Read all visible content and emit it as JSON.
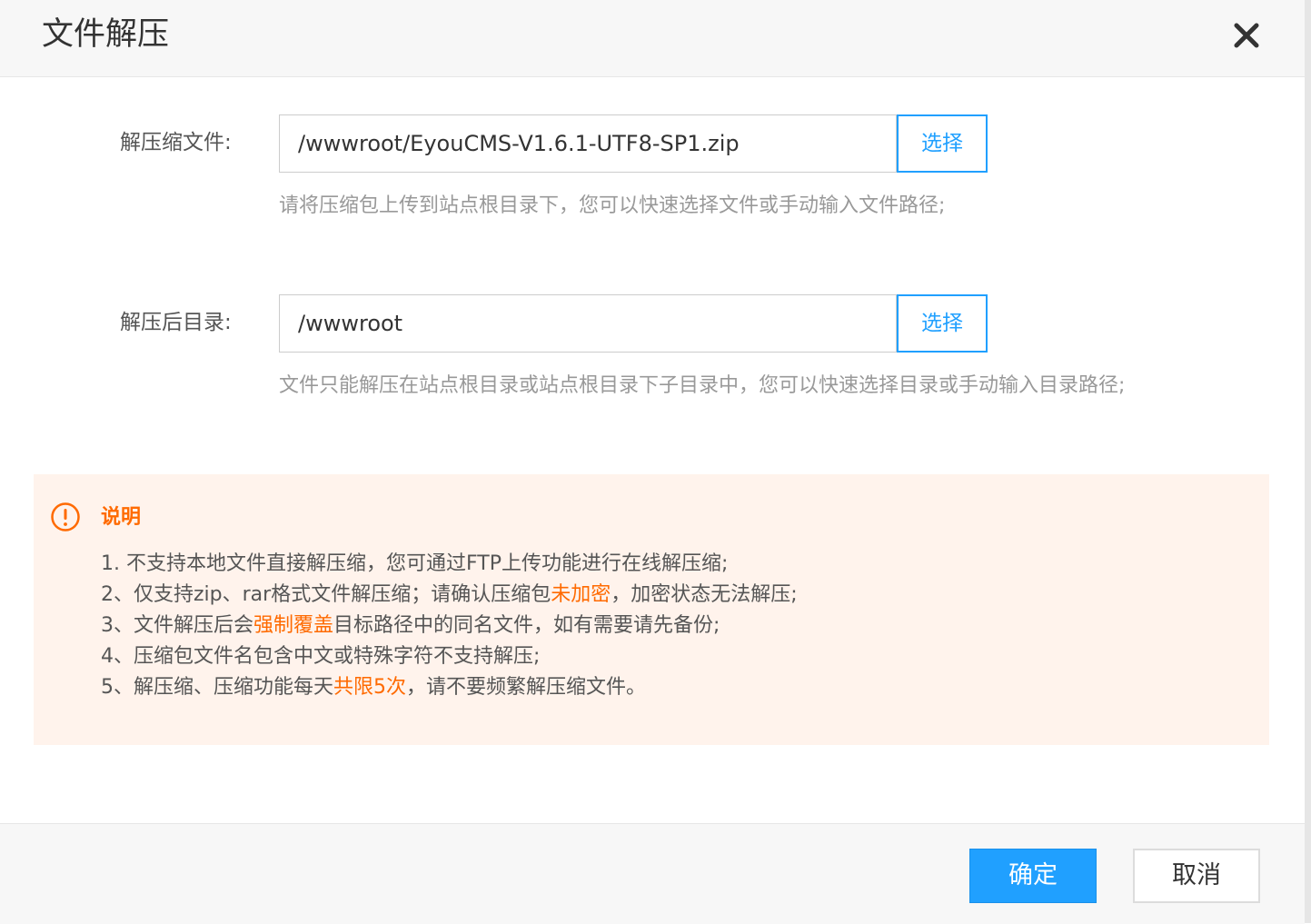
{
  "dialog": {
    "title": "文件解压",
    "close_icon": "close-icon"
  },
  "archive_file": {
    "label": "解压缩文件:",
    "value": "/wwwroot/EyouCMS-V1.6.1-UTF8-SP1.zip",
    "select_label": "选择",
    "hint": "请将压缩包上传到站点根目录下，您可以快速选择文件或手动输入文件路径;"
  },
  "target_dir": {
    "label": "解压后目录:",
    "value": "/wwwroot",
    "select_label": "选择",
    "hint": "文件只能解压在站点根目录或站点根目录下子目录中，您可以快速选择目录或手动输入目录路径;"
  },
  "notice": {
    "icon": "warning-circle-icon",
    "title": "说明",
    "items": [
      {
        "before": "1. 不支持本地文件直接解压缩，您可通过FTP上传功能进行在线解压缩;",
        "highlight": "",
        "after": ""
      },
      {
        "before": "2、仅支持zip、rar格式文件解压缩；请确认压缩包",
        "highlight": "未加密",
        "after": "，加密状态无法解压;"
      },
      {
        "before": "3、文件解压后会",
        "highlight": "强制覆盖",
        "after": "目标路径中的同名文件，如有需要请先备份;"
      },
      {
        "before": "4、压缩包文件名包含中文或特殊字符不支持解压;",
        "highlight": "",
        "after": ""
      },
      {
        "before": "5、解压缩、压缩功能每天",
        "highlight": "共限5次",
        "after": "，请不要频繁解压缩文件。"
      }
    ],
    "highlight_color": "#ff6a00"
  },
  "footer": {
    "confirm_label": "确定",
    "cancel_label": "取消"
  },
  "colors": {
    "accent": "#20a0ff",
    "warning": "#ff6a00",
    "notice_bg": "#fff3ec"
  }
}
